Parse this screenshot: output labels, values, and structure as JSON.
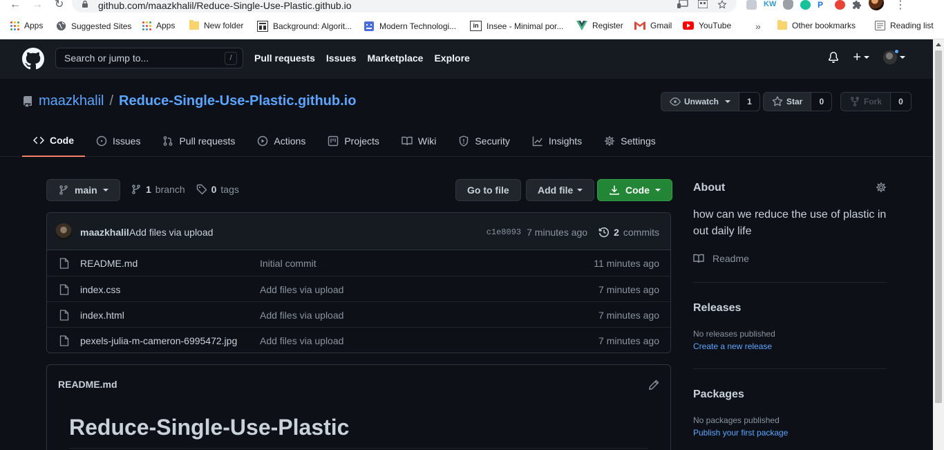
{
  "browser": {
    "url": "github.com/maazkhalil/Reduce-Single-Use-Plastic.github.io",
    "bookmarks": [
      {
        "label": "Apps"
      },
      {
        "label": "Suggested Sites"
      },
      {
        "label": "Apps"
      },
      {
        "label": "New folder"
      },
      {
        "label": "Background: Algorit..."
      },
      {
        "label": "Modern Technologi..."
      },
      {
        "label": "Insee - Minimal por..."
      },
      {
        "label": "Register"
      },
      {
        "label": "Gmail"
      },
      {
        "label": "YouTube"
      }
    ],
    "bookmarks_overflow": "»",
    "other_bookmarks": "Other bookmarks",
    "reading_list": "Reading list"
  },
  "header": {
    "search_placeholder": "Search or jump to...",
    "search_shortcut": "/",
    "nav": [
      "Pull requests",
      "Issues",
      "Marketplace",
      "Explore"
    ]
  },
  "repo": {
    "owner": "maazkhalil",
    "separator": "/",
    "name": "Reduce-Single-Use-Plastic.github.io",
    "watch_label": "Unwatch",
    "watch_count": "1",
    "star_label": "Star",
    "star_count": "0",
    "fork_label": "Fork",
    "fork_count": "0",
    "tabs": [
      {
        "label": "Code",
        "icon": "code-icon"
      },
      {
        "label": "Issues",
        "icon": "issue-icon"
      },
      {
        "label": "Pull requests",
        "icon": "pull-request-icon"
      },
      {
        "label": "Actions",
        "icon": "play-icon"
      },
      {
        "label": "Projects",
        "icon": "project-icon"
      },
      {
        "label": "Wiki",
        "icon": "book-icon"
      },
      {
        "label": "Security",
        "icon": "shield-icon"
      },
      {
        "label": "Insights",
        "icon": "graph-icon"
      },
      {
        "label": "Settings",
        "icon": "gear-icon"
      }
    ]
  },
  "branch": {
    "current": "main",
    "branch_count": "1",
    "branch_word": "branch",
    "tag_count": "0",
    "tag_word": "tags"
  },
  "actions": {
    "go_to_file": "Go to file",
    "add_file": "Add file",
    "code": "Code"
  },
  "latest_commit": {
    "author": "maazkhalil",
    "message": "Add files via upload",
    "sha": "c1e8093",
    "age": "7 minutes ago",
    "commit_count": "2",
    "commit_word": "commits"
  },
  "files": [
    {
      "name": "README.md",
      "message": "Initial commit",
      "age": "11 minutes ago"
    },
    {
      "name": "index.css",
      "message": "Add files via upload",
      "age": "7 minutes ago"
    },
    {
      "name": "index.html",
      "message": "Add files via upload",
      "age": "7 minutes ago"
    },
    {
      "name": "pexels-julia-m-cameron-6995472.jpg",
      "message": "Add files via upload",
      "age": "7 minutes ago"
    }
  ],
  "readme": {
    "filename": "README.md",
    "heading": "Reduce-Single-Use-Plastic"
  },
  "sidebar": {
    "about_title": "About",
    "description": "how can we reduce the use of plastic in out daily life",
    "readme_link": "Readme",
    "releases_title": "Releases",
    "releases_none": "No releases published",
    "releases_link": "Create a new release",
    "packages_title": "Packages",
    "packages_none": "No packages published",
    "packages_link": "Publish your first package"
  },
  "colors": {
    "bg": "#0d1117",
    "header_bg": "#161b22",
    "link": "#58a6ff",
    "code_button": "#238636",
    "active_tab_underline": "#f78166"
  }
}
